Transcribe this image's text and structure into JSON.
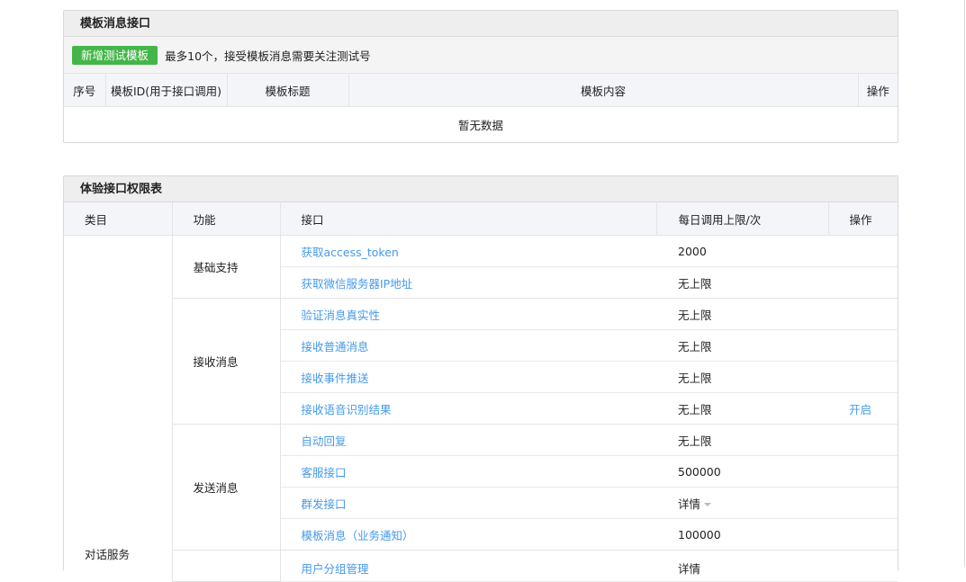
{
  "template_panel": {
    "title": "模板消息接口",
    "add_button": "新增测试模板",
    "tip": "最多10个，接受模板消息需要关注测试号",
    "columns": [
      "序号",
      "模板ID(用于接口调用)",
      "模板标题",
      "模板内容",
      "操作"
    ],
    "empty_text": "暂无数据"
  },
  "permission_panel": {
    "title": "体验接口权限表",
    "columns": [
      "类目",
      "功能",
      "接口",
      "每日调用上限/次",
      "操作"
    ],
    "category": "对话服务",
    "groups": [
      {
        "func": "基础支持",
        "rows": [
          {
            "api": "获取access_token",
            "limit": "2000",
            "op": ""
          },
          {
            "api": "获取微信服务器IP地址",
            "limit": "无上限",
            "op": ""
          }
        ]
      },
      {
        "func": "接收消息",
        "rows": [
          {
            "api": "验证消息真实性",
            "limit": "无上限",
            "op": ""
          },
          {
            "api": "接收普通消息",
            "limit": "无上限",
            "op": ""
          },
          {
            "api": "接收事件推送",
            "limit": "无上限",
            "op": ""
          },
          {
            "api": "接收语音识别结果",
            "limit": "无上限",
            "op": "开启"
          }
        ]
      },
      {
        "func": "发送消息",
        "rows": [
          {
            "api": "自动回复",
            "limit": "无上限",
            "op": ""
          },
          {
            "api": "客服接口",
            "limit": "500000",
            "op": ""
          },
          {
            "api": "群发接口",
            "limit": "详情",
            "op": ""
          },
          {
            "api": "模板消息（业务通知）",
            "limit": "100000",
            "op": ""
          }
        ]
      }
    ],
    "partial_row": {
      "api": "用户分组管理",
      "limit": "详情"
    }
  }
}
